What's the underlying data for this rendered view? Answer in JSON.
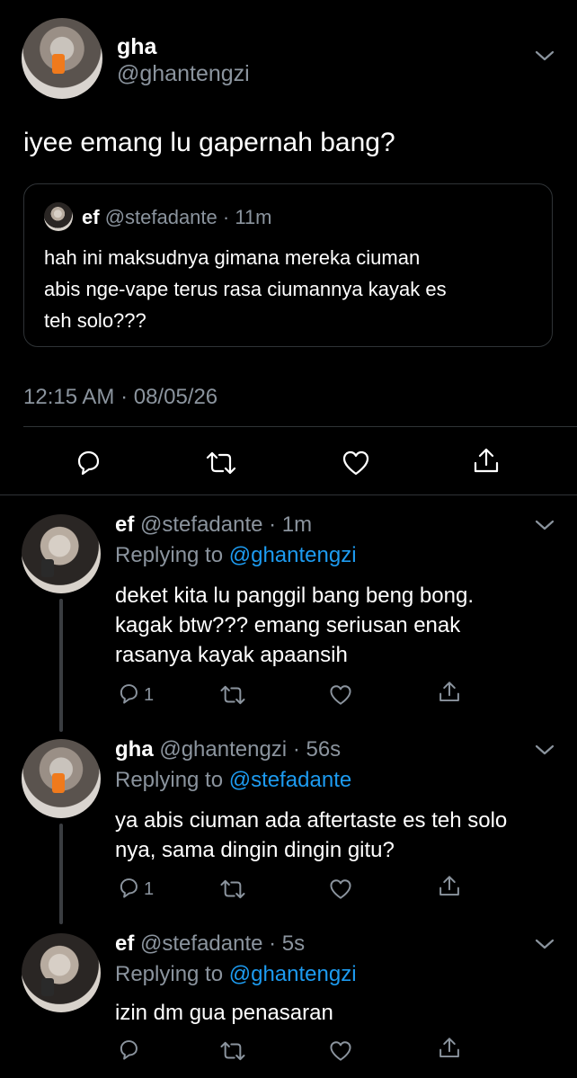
{
  "main_tweet": {
    "name": "gha",
    "handle": "@ghantengzi",
    "text": "iyee emang lu gapernah bang?",
    "timestamp": "12:15 AM · 08/05/26",
    "quote": {
      "name": "ef",
      "handle": "@stefadante",
      "time": "· 11m",
      "text_lines": [
        "hah ini maksudnya gimana mereka ciuman",
        "abis nge-vape terus rasa ciumannya kayak es",
        "teh solo???"
      ]
    }
  },
  "replies": [
    {
      "name": "ef",
      "handle": "@stefadante",
      "time": "· 1m",
      "replying_prefix": "Replying to",
      "replying_to": "@ghantengzi",
      "text_lines": [
        "deket kita lu panggil bang beng bong.",
        "kagak btw??? emang seriusan enak",
        "rasanya kayak apaansih"
      ],
      "reply_count": "1"
    },
    {
      "name": "gha",
      "handle": "@ghantengzi",
      "time": "· 56s",
      "replying_prefix": "Replying to",
      "replying_to": "@stefadante",
      "text_lines": [
        "ya abis ciuman ada aftertaste es teh solo",
        "nya, sama dingin dingin gitu?"
      ],
      "reply_count": "1"
    },
    {
      "name": "ef",
      "handle": "@stefadante",
      "time": "· 5s",
      "replying_prefix": "Replying to",
      "replying_to": "@ghantengzi",
      "text_lines": [
        "izin dm gua penasaran"
      ],
      "reply_count": ""
    }
  ],
  "colors": {
    "background": "#000000",
    "muted": "#8b949e",
    "link": "#1d9bf0",
    "border": "#2f3336"
  },
  "icons": [
    "chevron-down-icon",
    "reply-icon",
    "retweet-icon",
    "like-icon",
    "share-icon"
  ]
}
